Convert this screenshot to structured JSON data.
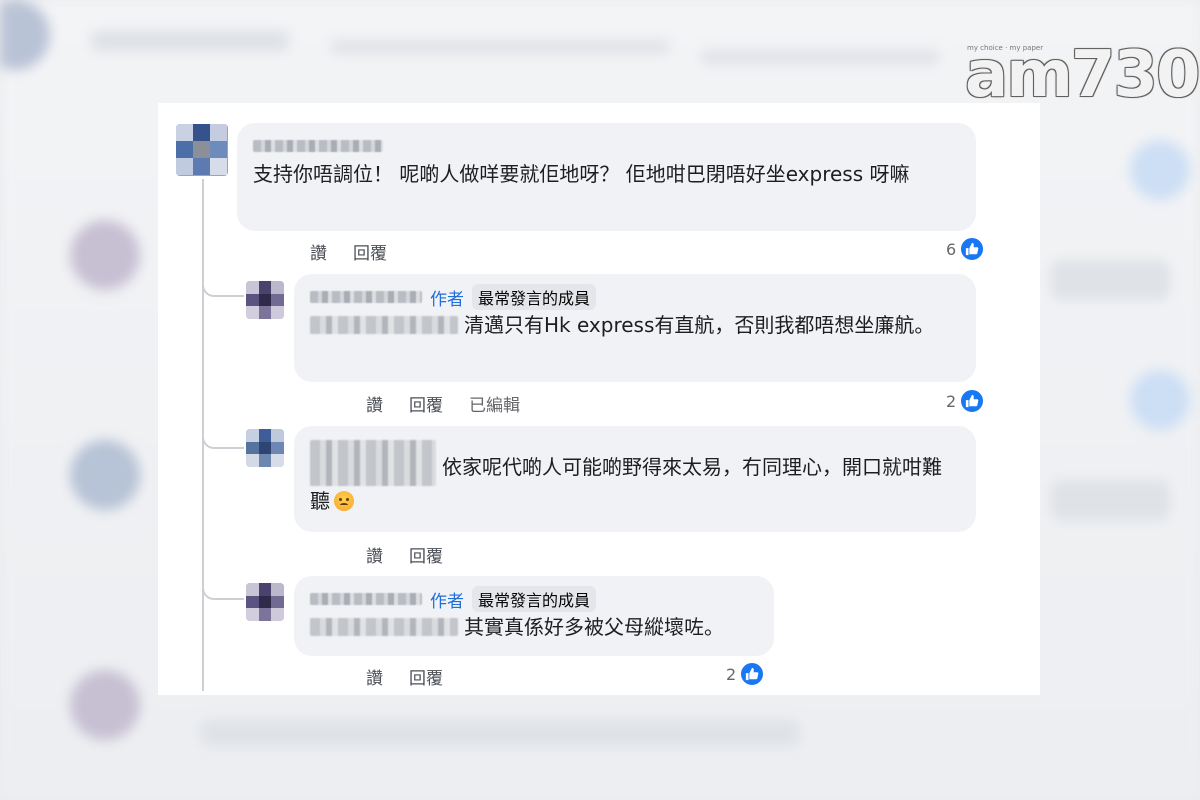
{
  "logo": {
    "tagline": "my choice · my paper",
    "text": "am730"
  },
  "comments": [
    {
      "text": "支持你唔調位！ 呢啲人做咩要就佢地呀？ 佢地咁巴閉唔好坐express 呀嘛",
      "actions": {
        "like": "讚",
        "reply": "回覆"
      },
      "like_count": "6"
    },
    {
      "author_tag": "作者",
      "badge": "最常發言的成員",
      "text": "清邁只有Hk express有直航，否則我都唔想坐廉航。",
      "actions": {
        "like": "讚",
        "reply": "回覆",
        "edited": "已編輯"
      },
      "like_count": "2"
    },
    {
      "text": "依家呢代啲人可能啲野得來太易，冇同理心，開口就咁難聽",
      "emoji": "disappointed-face-emoji",
      "actions": {
        "like": "讚",
        "reply": "回覆"
      }
    },
    {
      "author_tag": "作者",
      "badge": "最常發言的成員",
      "text": "其實真係好多被父母縱壞咗。",
      "actions": {
        "like": "讚",
        "reply": "回覆"
      },
      "like_count": "2"
    }
  ],
  "colors": {
    "bubble": "#f0f2f5",
    "author_tag": "#216fdb",
    "like_blue": "#1877f2",
    "thread_line": "#ccd0d5"
  },
  "icons": {
    "like": "thumbs-up-icon"
  }
}
